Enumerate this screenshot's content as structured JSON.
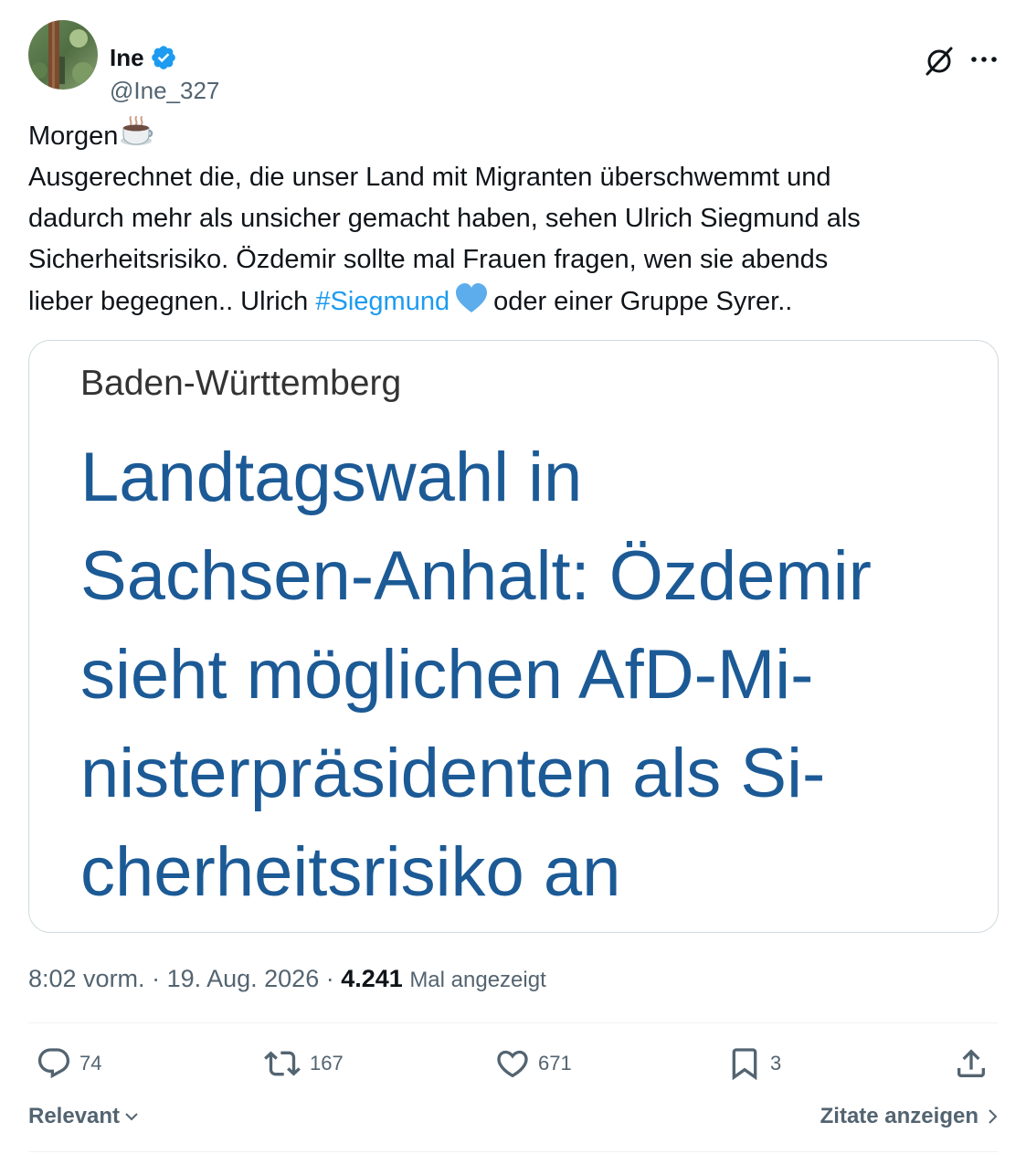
{
  "author": {
    "name": "Ine",
    "handle": "@Ine_327",
    "verified": true,
    "verified_color": "#1d9bf0"
  },
  "header_icons": [
    "grok-icon",
    "more-icon"
  ],
  "tweet": {
    "line1": "Morgen",
    "line2": "Ausgerechnet die, die unser Land mit Migranten überschwemmt und",
    "line3": "dadurch mehr als unsicher gemacht haben, sehen Ulrich Siegmund als",
    "line4": "Sicherheitsrisiko. Özdemir sollte mal Frauen fragen, wen sie abends",
    "line5_before": "lieber begegnen.. Ulrich ",
    "hashtag": "#Siegmund",
    "line5_after": "oder einer Gruppe Syrer..",
    "hashtag_color": "#1d9bf0"
  },
  "media": {
    "kicker": "Baden-Württemberg",
    "headline_lines": [
      "Landtagswahl in",
      "Sachsen-Anhalt: Özdemir",
      "sieht möglichen AfD-Mi-",
      "nisterpräsidenten als Si-",
      "cherheitsrisiko an"
    ],
    "headline_color": "#1c5a96"
  },
  "meta": {
    "time": "8:02 vorm.",
    "sep": " · ",
    "date": "19. Aug. 2026",
    "views_count": "4.241",
    "views_label": "Mal angezeigt"
  },
  "actions": {
    "replies": "74",
    "reposts": "167",
    "likes": "671",
    "bookmarks": "3"
  },
  "footer": {
    "sort_label": "Relevant",
    "quotes_label": "Zitate anzeigen"
  }
}
